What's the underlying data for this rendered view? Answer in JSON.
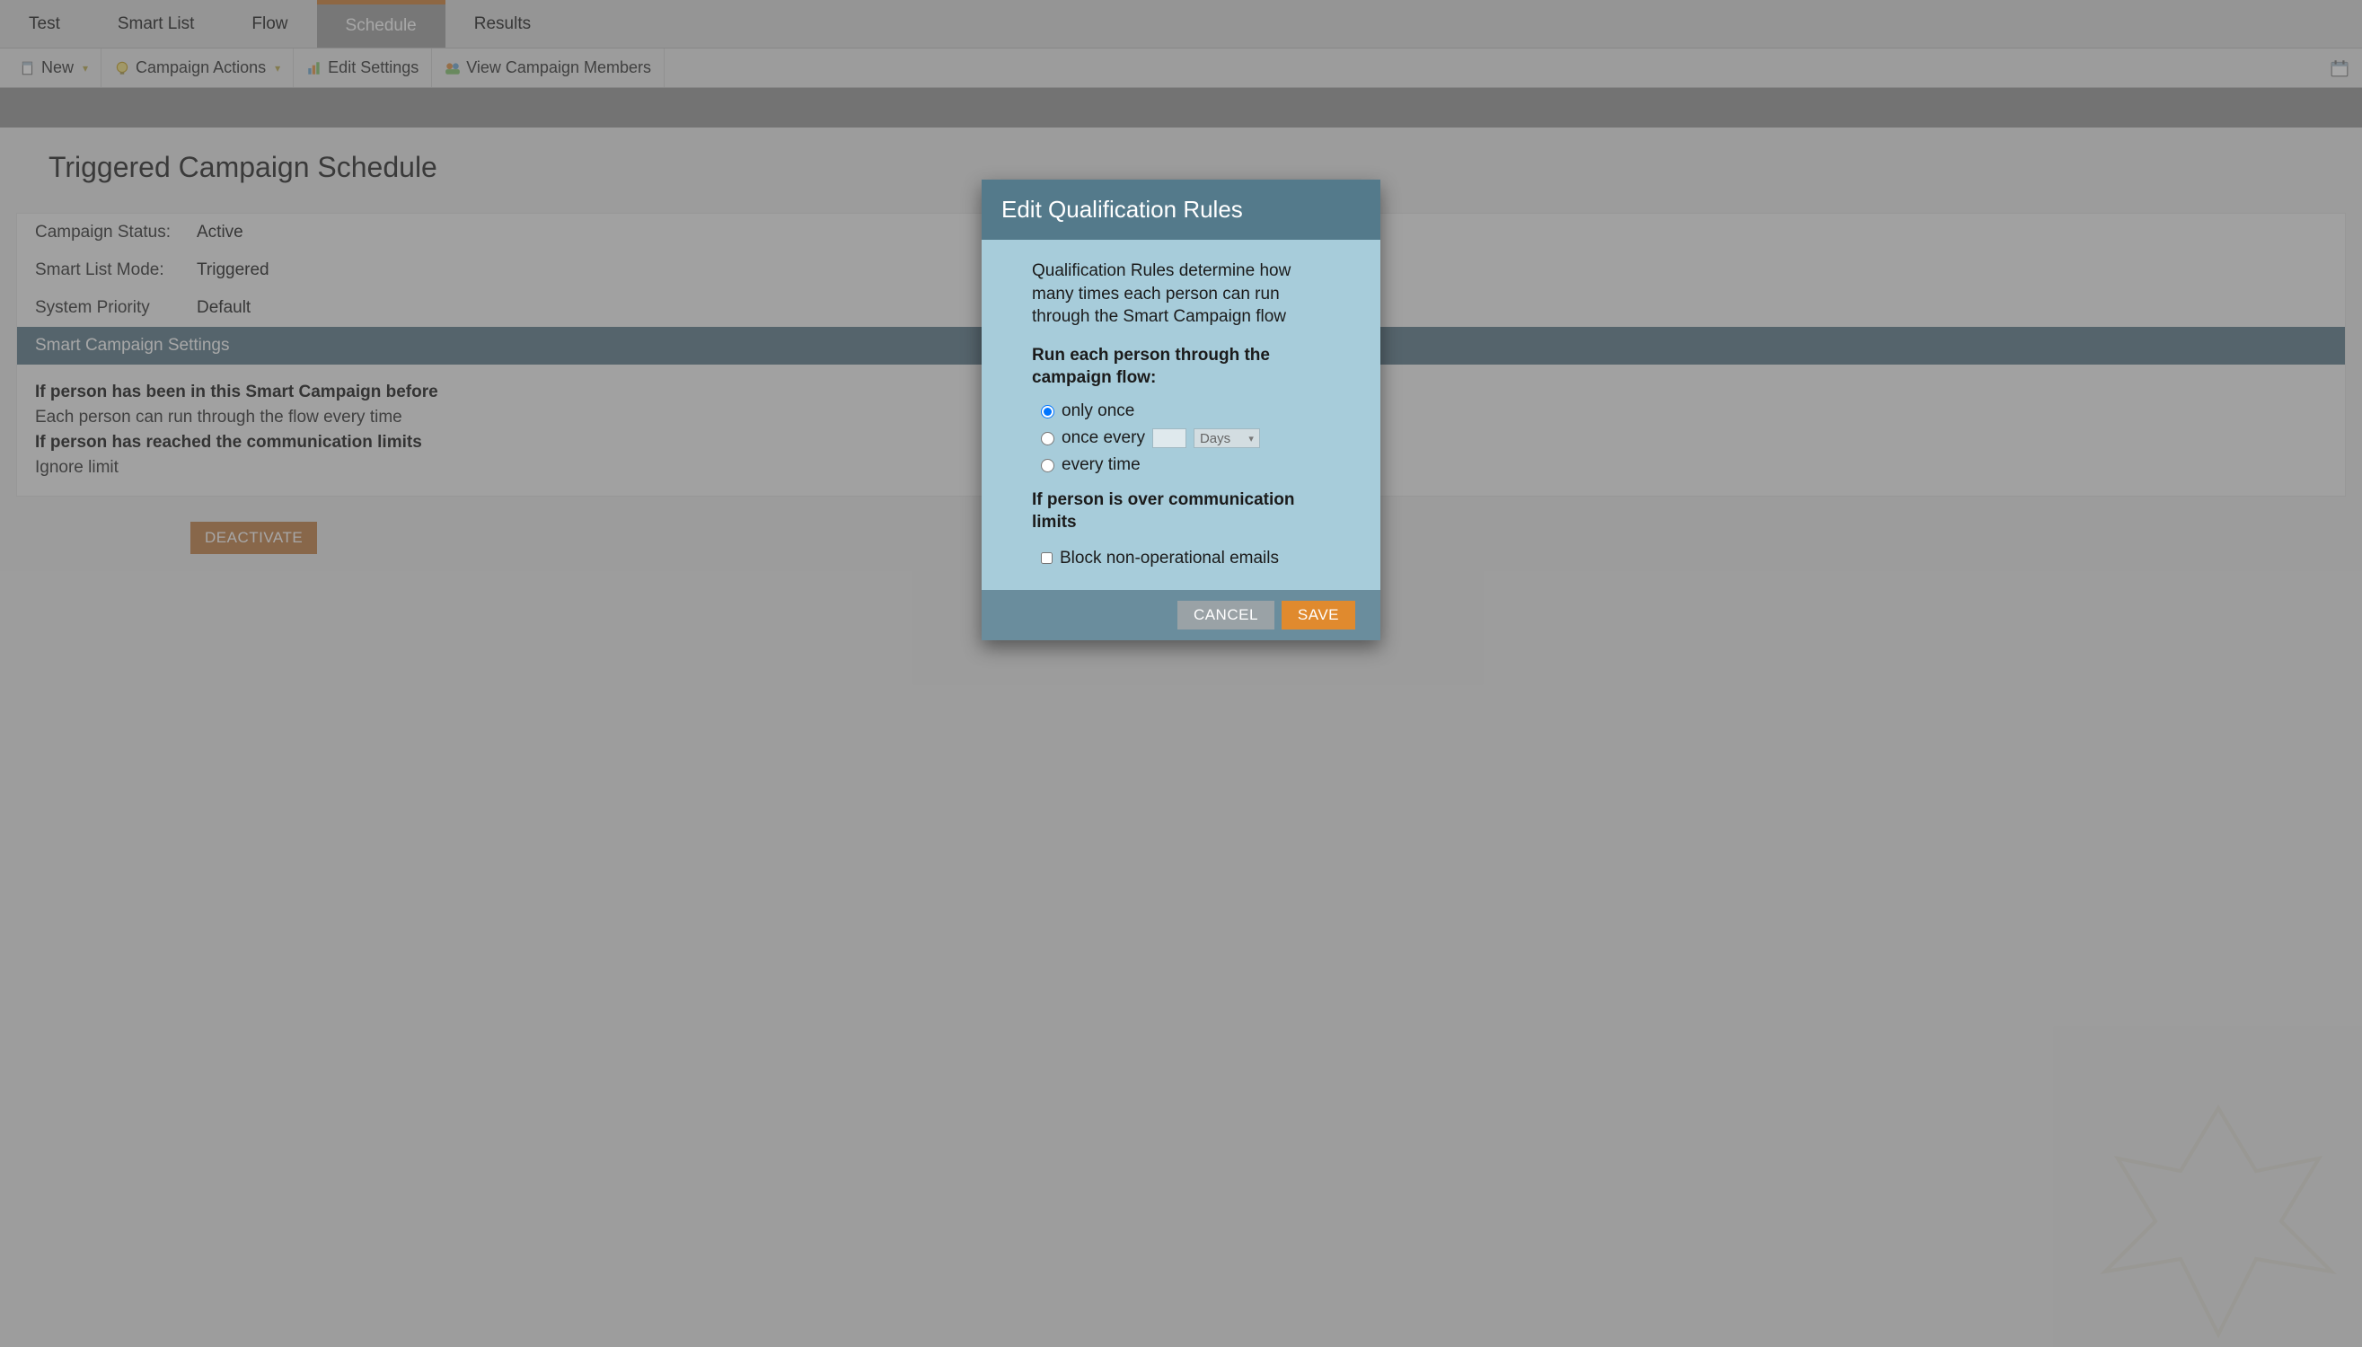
{
  "tabs": {
    "test": "Test",
    "smart_list": "Smart List",
    "flow": "Flow",
    "schedule": "Schedule",
    "results": "Results"
  },
  "toolbar": {
    "new": "New",
    "campaign_actions": "Campaign Actions",
    "edit_settings": "Edit Settings",
    "view_members": "View Campaign Members"
  },
  "page": {
    "title": "Triggered Campaign Schedule"
  },
  "status": {
    "campaign_status_label": "Campaign Status:",
    "campaign_status_value": "Active",
    "smart_list_mode_label": "Smart List Mode:",
    "smart_list_mode_value": "Triggered",
    "system_priority_label": "System Priority",
    "system_priority_value": "Default"
  },
  "settings": {
    "header": "Smart Campaign Settings",
    "line1": "If person has been in this Smart Campaign before",
    "line2": "Each person can run through the flow every time",
    "line3": "If person has reached the communication limits",
    "line4": "Ignore limit"
  },
  "deactivate_label": "DEACTIVATE",
  "modal": {
    "title": "Edit Qualification Rules",
    "intro": "Qualification Rules determine how many times each person can run through the Smart Campaign flow",
    "heading": "Run each person through the campaign flow:",
    "opt_once": "only once",
    "opt_every": "once every",
    "unit": "Days",
    "opt_everytime": "every time",
    "comm_heading": "If person is over communication limits",
    "block_label": "Block non-operational emails",
    "cancel": "CANCEL",
    "save": "SAVE"
  }
}
